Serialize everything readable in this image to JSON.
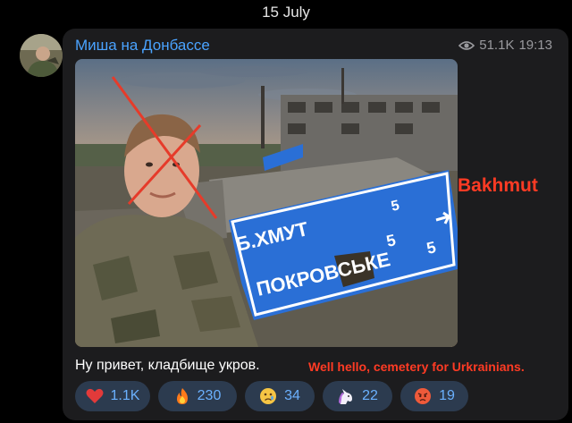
{
  "date": "15 July",
  "post": {
    "channel_name": "Миша на Донбассе",
    "views": "51.1K",
    "time": "19:13",
    "caption": "Ну привет, кладбище укров.",
    "caption_translation": "Well hello, cemetery for Urkrainians."
  },
  "annotation": {
    "place_label": "Bakhmut",
    "color": "#ff3b24"
  },
  "photo_sign": {
    "line1": "Б.ХМУТ",
    "line1_distance": "5",
    "line2": "ПОКРОВСЬКЕ",
    "line2_distance": "5",
    "top_number": "5"
  },
  "reactions": [
    {
      "icon": "heart-icon",
      "count": "1.1K"
    },
    {
      "icon": "fire-icon",
      "count": "230"
    },
    {
      "icon": "crying-face-icon",
      "count": "34"
    },
    {
      "icon": "unicorn-icon",
      "count": "22"
    },
    {
      "icon": "angry-face-icon",
      "count": "19"
    }
  ],
  "colors": {
    "accent": "#4aa3ff",
    "reaction_bg": "#2c3b4f",
    "sign_blue": "#2a6fd6"
  }
}
